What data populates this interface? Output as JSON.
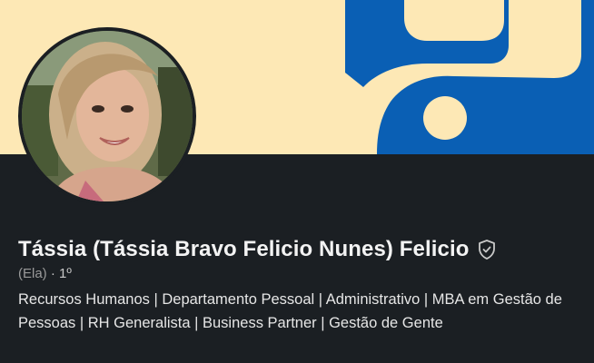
{
  "profile": {
    "name": "Tássia (Tássia Bravo Felicio Nunes) Felicio",
    "pronouns": "(Ela)",
    "separator": "·",
    "connection_degree": "1º",
    "headline": "Recursos Humanos | Departamento Pessoal | Administrativo | MBA em Gestão de Pessoas | RH Generalista | Business Partner | Gestão de Gente"
  },
  "icons": {
    "verified": "shield-check-icon"
  },
  "colors": {
    "banner_background": "#fde8b5",
    "banner_accent": "#0a5fb4",
    "card_background": "#1b1f23",
    "name_text": "#f3f3f3",
    "secondary_text": "#9a9a9a"
  }
}
